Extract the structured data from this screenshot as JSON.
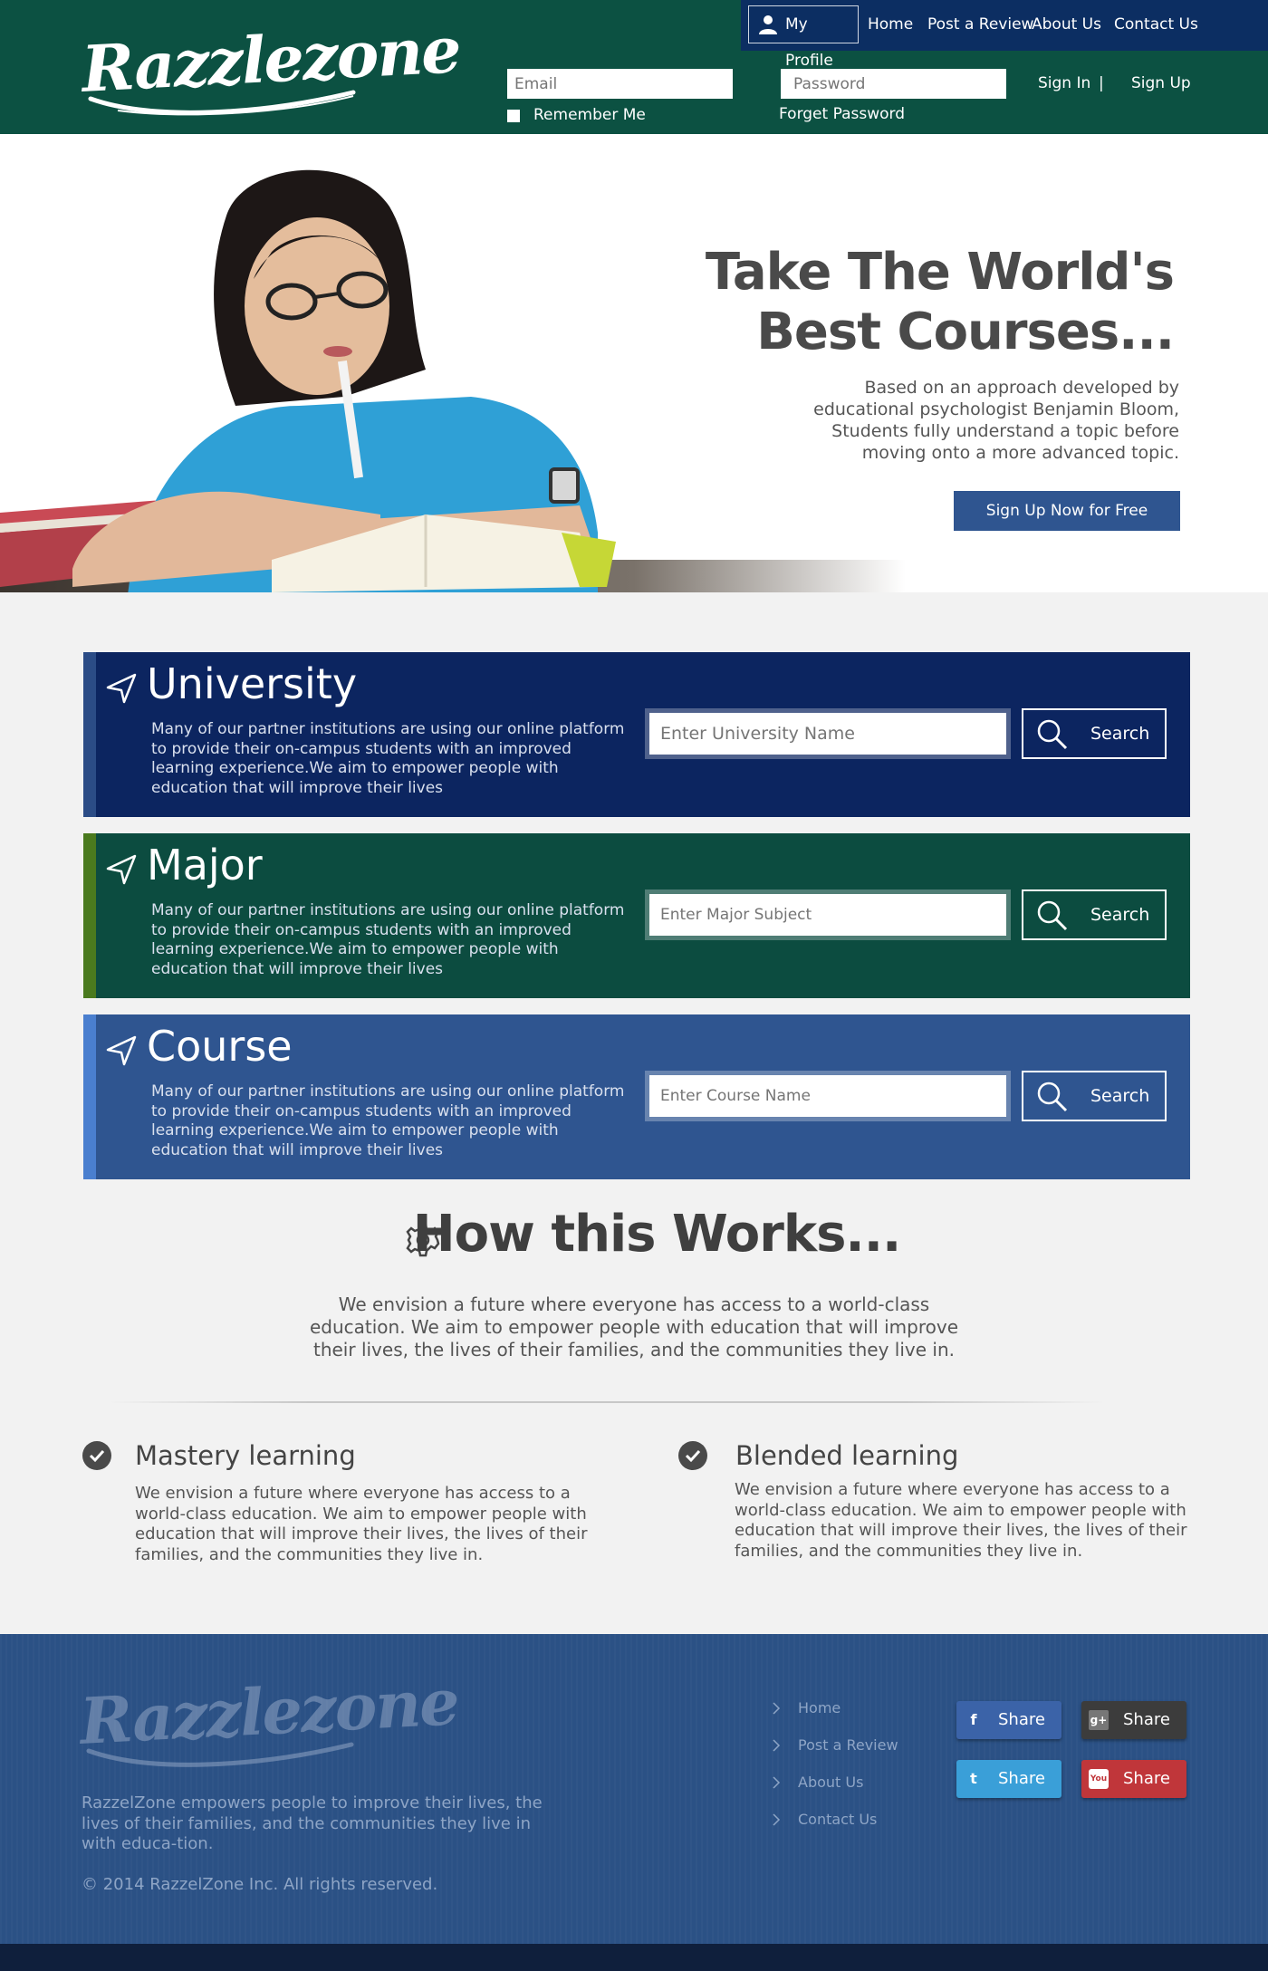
{
  "brand": {
    "name": "Razzlezone"
  },
  "topnav": {
    "profile": "My Profile",
    "items": [
      "Home",
      "Post a Review",
      "About Us",
      "Contact Us"
    ]
  },
  "login": {
    "email_placeholder": "Email",
    "password_placeholder": "Password",
    "remember": "Remember Me",
    "forgot": "Forget Password",
    "sign_in": "Sign In",
    "separator": "|",
    "sign_up": "Sign Up"
  },
  "hero": {
    "title_line1": "Take The World's",
    "title_line2": "Best Courses...",
    "text": "Based on an approach developed by educational psychologist Benjamin Bloom, Students fully understand a topic before moving onto a more advanced topic.",
    "cta": "Sign Up Now for Free"
  },
  "panels": [
    {
      "title": "University",
      "description": "Many of our partner institutions are using our online platform to provide their on-campus students with an improved learning experience.We aim to empower people with education that will improve their lives",
      "placeholder": "Enter University Name",
      "button": "Search",
      "color": "#0c2560",
      "stripe": "#2b4c86"
    },
    {
      "title": "Major",
      "description": "Many of our partner institutions are using our online platform to provide their on-campus students with an improved learning experience.We aim to empower people with education that will improve their lives",
      "placeholder": "Enter Major Subject",
      "button": "Search",
      "color": "#0c4c40",
      "stripe": "#4a7a1e"
    },
    {
      "title": "Course",
      "description": "Many of our partner institutions are using our online platform to provide their on-campus students with an improved learning experience.We aim to empower people with education that will improve their lives",
      "placeholder": "Enter Course Name",
      "button": "Search",
      "color": "#2f5590",
      "stripe": "#4a7fcf"
    }
  ],
  "how": {
    "title": "How this Works...",
    "text": "We envision a future where everyone has access to a world-class education. We aim to empower people with education that will improve their lives, the lives of their families, and the communities they live in."
  },
  "features": [
    {
      "title": "Mastery learning",
      "text": "We envision a future where everyone has access to a world-class education. We aim to empower people with education that will improve their lives, the lives of their families, and the communities they live in."
    },
    {
      "title": "Blended learning",
      "text": "We envision a future where everyone has access to a world-class education. We aim to empower people with education that will improve their lives, the lives of their families, and the communities they live in."
    }
  ],
  "footer": {
    "text": "RazzelZone  empowers people to improve their lives, the lives of their families, and the communities they live in with educa-tion.",
    "copyright": "© 2014 RazzelZone Inc. All rights reserved.",
    "links": [
      "Home",
      "Post a Review",
      "About Us",
      "Contact Us"
    ],
    "share_label": "Share",
    "share": [
      {
        "network": "facebook",
        "icon": "f",
        "color": "#3b63a8"
      },
      {
        "network": "google-plus",
        "icon": "g+",
        "color": "#3c3c3c"
      },
      {
        "network": "twitter",
        "icon": "t",
        "color": "#3a9fd8"
      },
      {
        "network": "youtube",
        "icon": "You",
        "color": "#c0363a"
      }
    ]
  }
}
